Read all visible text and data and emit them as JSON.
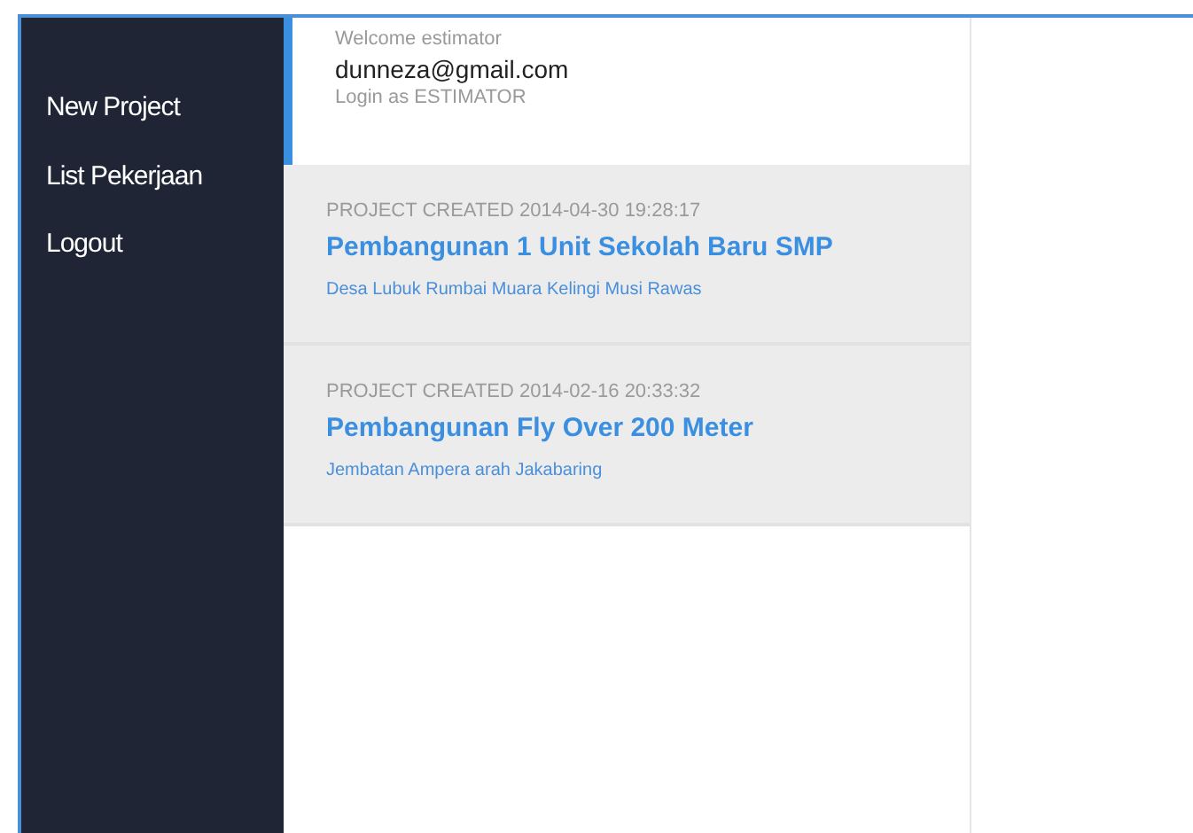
{
  "sidebar": {
    "items": [
      {
        "label": "New Project"
      },
      {
        "label": "List Pekerjaan"
      },
      {
        "label": "Logout"
      }
    ]
  },
  "user": {
    "welcome": "Welcome estimator",
    "email": "dunneza@gmail.com",
    "role": "Login as ESTIMATOR"
  },
  "projects": [
    {
      "created": "PROJECT CREATED 2014-04-30 19:28:17",
      "title": "Pembangunan 1 Unit Sekolah Baru SMP",
      "location": "Desa Lubuk Rumbai Muara Kelingi Musi Rawas"
    },
    {
      "created": "PROJECT CREATED 2014-02-16 20:33:32",
      "title": "Pembangunan Fly Over 200 Meter",
      "location": "Jembatan Ampera arah Jakabaring"
    }
  ]
}
